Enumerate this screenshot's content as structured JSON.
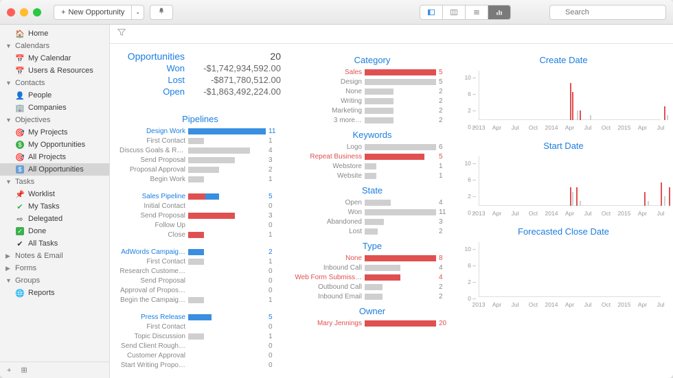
{
  "toolbar": {
    "new_label": "New Opportunity",
    "search_placeholder": "Search"
  },
  "sidebar": {
    "home": "Home",
    "sections": {
      "calendars": {
        "label": "Calendars",
        "items": [
          "My Calendar",
          "Users & Resources"
        ]
      },
      "contacts": {
        "label": "Contacts",
        "items": [
          "People",
          "Companies"
        ]
      },
      "objectives": {
        "label": "Objectives",
        "items": [
          "My Projects",
          "My Opportunities",
          "All Projects",
          "All Opportunities"
        ]
      },
      "tasks": {
        "label": "Tasks",
        "items": [
          "Worklist",
          "My Tasks",
          "Delegated",
          "Done",
          "All Tasks"
        ]
      },
      "notes": {
        "label": "Notes & Email"
      },
      "forms": {
        "label": "Forms"
      },
      "groups": {
        "label": "Groups",
        "items": [
          "Reports"
        ]
      }
    }
  },
  "summary": {
    "title": "Opportunities",
    "count": "20",
    "won_label": "Won",
    "won_value": "-$1,742,934,592.00",
    "lost_label": "Lost",
    "lost_value": "-$871,780,512.00",
    "open_label": "Open",
    "open_value": "-$1,863,492,224.00"
  },
  "pipelines_h": "Pipelines",
  "pipelines": [
    {
      "name": "Design Work",
      "total": "11",
      "stages": [
        {
          "label": "First Contact",
          "val": "1"
        },
        {
          "label": "Discuss Goals & Re…",
          "val": "4"
        },
        {
          "label": "Send Proposal",
          "val": "3"
        },
        {
          "label": "Proposal Approval",
          "val": "2"
        },
        {
          "label": "Begin Work",
          "val": "1"
        }
      ]
    },
    {
      "name": "Sales Pipeline",
      "total": "5",
      "stages": [
        {
          "label": "Initial Contact",
          "val": "0"
        },
        {
          "label": "Send Proposal",
          "val": "3"
        },
        {
          "label": "Follow Up",
          "val": "0"
        },
        {
          "label": "Close",
          "val": "1"
        }
      ]
    },
    {
      "name": "AdWords Campaig…",
      "total": "2",
      "stages": [
        {
          "label": "First Contact",
          "val": "1"
        },
        {
          "label": "Research Custome…",
          "val": "0"
        },
        {
          "label": "Send Proposal",
          "val": "0"
        },
        {
          "label": "Approval of Propos…",
          "val": "0"
        },
        {
          "label": "Begin the Campaig…",
          "val": "1"
        }
      ]
    },
    {
      "name": "Press Release",
      "total": "5",
      "stages": [
        {
          "label": "First Contact",
          "val": "0"
        },
        {
          "label": "Topic Discussion",
          "val": "1"
        },
        {
          "label": "Send Client Rough…",
          "val": "0"
        },
        {
          "label": "Customer Approval",
          "val": "0"
        },
        {
          "label": "Start Writing Propo…",
          "val": "0"
        }
      ]
    }
  ],
  "col2": {
    "category_h": "Category",
    "category": [
      {
        "label": "Sales",
        "val": "5",
        "cls": "red"
      },
      {
        "label": "Design",
        "val": "5"
      },
      {
        "label": "None",
        "val": "2"
      },
      {
        "label": "Writing",
        "val": "2"
      },
      {
        "label": "Marketing",
        "val": "2"
      },
      {
        "label": "3 more…",
        "val": "2"
      }
    ],
    "keywords_h": "Keywords",
    "keywords": [
      {
        "label": "Logo",
        "val": "6"
      },
      {
        "label": "Repeat Business",
        "val": "5",
        "cls": "red"
      },
      {
        "label": "Webstore",
        "val": "1"
      },
      {
        "label": "Website",
        "val": "1"
      }
    ],
    "state_h": "State",
    "state": [
      {
        "label": "Open",
        "val": "4"
      },
      {
        "label": "Won",
        "val": "11"
      },
      {
        "label": "Abandoned",
        "val": "3"
      },
      {
        "label": "Lost",
        "val": "2"
      }
    ],
    "type_h": "Type",
    "type": [
      {
        "label": "None",
        "val": "8",
        "cls": "red"
      },
      {
        "label": "Inbound Call",
        "val": "4"
      },
      {
        "label": "Web Form Submiss…",
        "val": "4",
        "cls": "red"
      },
      {
        "label": "Outbound Call",
        "val": "2"
      },
      {
        "label": "Inbound Email",
        "val": "2"
      }
    ],
    "owner_h": "Owner",
    "owner": [
      {
        "label": "Mary Jennings",
        "val": "20",
        "cls": "red"
      }
    ]
  },
  "col3": {
    "create_h": "Create Date",
    "start_h": "Start Date",
    "forecast_h": "Forecasted Close Date",
    "xticks": [
      "2013",
      "Apr",
      "Jul",
      "Oct",
      "2014",
      "Apr",
      "Jul",
      "Oct",
      "2015",
      "Apr",
      "Jul"
    ],
    "yticks": [
      "10",
      "6",
      "2",
      "0"
    ]
  },
  "chart_data": [
    {
      "type": "bar",
      "title": "Pipelines — Design Work",
      "categories": [
        "First Contact",
        "Discuss Goals & Re…",
        "Send Proposal",
        "Proposal Approval",
        "Begin Work"
      ],
      "values": [
        1,
        4,
        3,
        2,
        1
      ],
      "total": 11
    },
    {
      "type": "bar",
      "title": "Pipelines — Sales Pipeline",
      "categories": [
        "Initial Contact",
        "Send Proposal",
        "Follow Up",
        "Close"
      ],
      "values": [
        0,
        3,
        0,
        1
      ],
      "total": 5
    },
    {
      "type": "bar",
      "title": "Pipelines — AdWords Campaign",
      "categories": [
        "First Contact",
        "Research Custome…",
        "Send Proposal",
        "Approval of Propos…",
        "Begin the Campaig…"
      ],
      "values": [
        1,
        0,
        0,
        0,
        1
      ],
      "total": 2
    },
    {
      "type": "bar",
      "title": "Pipelines — Press Release",
      "categories": [
        "First Contact",
        "Topic Discussion",
        "Send Client Rough…",
        "Customer Approval",
        "Start Writing Propo…"
      ],
      "values": [
        0,
        1,
        0,
        0,
        0
      ],
      "total": 5
    },
    {
      "type": "bar",
      "title": "Category",
      "categories": [
        "Sales",
        "Design",
        "None",
        "Writing",
        "Marketing",
        "3 more…"
      ],
      "values": [
        5,
        5,
        2,
        2,
        2,
        2
      ]
    },
    {
      "type": "bar",
      "title": "Keywords",
      "categories": [
        "Logo",
        "Repeat Business",
        "Webstore",
        "Website"
      ],
      "values": [
        6,
        5,
        1,
        1
      ]
    },
    {
      "type": "bar",
      "title": "State",
      "categories": [
        "Open",
        "Won",
        "Abandoned",
        "Lost"
      ],
      "values": [
        4,
        11,
        3,
        2
      ]
    },
    {
      "type": "bar",
      "title": "Type",
      "categories": [
        "None",
        "Inbound Call",
        "Web Form Submiss…",
        "Outbound Call",
        "Inbound Email"
      ],
      "values": [
        8,
        4,
        4,
        2,
        2
      ]
    },
    {
      "type": "bar",
      "title": "Owner",
      "categories": [
        "Mary Jennings"
      ],
      "values": [
        20
      ]
    },
    {
      "type": "bar",
      "title": "Create Date",
      "xlabel": "",
      "ylabel": "",
      "ylim": [
        0,
        10
      ],
      "x": [
        "2013",
        "Apr",
        "Jul",
        "Oct",
        "2014",
        "Apr",
        "Jul",
        "Oct",
        "2015",
        "Apr",
        "Jul"
      ],
      "series": [
        {
          "name": "count",
          "values": [
            0,
            0,
            0,
            0,
            0,
            8,
            2,
            1,
            0,
            0,
            2
          ]
        }
      ]
    },
    {
      "type": "bar",
      "title": "Start Date",
      "xlabel": "",
      "ylabel": "",
      "ylim": [
        0,
        10
      ],
      "x": [
        "2013",
        "Apr",
        "Jul",
        "Oct",
        "2014",
        "Apr",
        "Jul",
        "Oct",
        "2015",
        "Apr",
        "Jul"
      ],
      "series": [
        {
          "name": "count",
          "values": [
            0,
            0,
            0,
            0,
            0,
            4,
            1,
            0,
            0,
            3,
            5
          ]
        }
      ]
    },
    {
      "type": "bar",
      "title": "Forecasted Close Date",
      "xlabel": "",
      "ylabel": "",
      "x": [
        "2013",
        "Apr",
        "Jul",
        "Oct",
        "2014",
        "Apr",
        "Jul",
        "Oct",
        "2015",
        "Apr",
        "Jul"
      ],
      "series": []
    }
  ]
}
